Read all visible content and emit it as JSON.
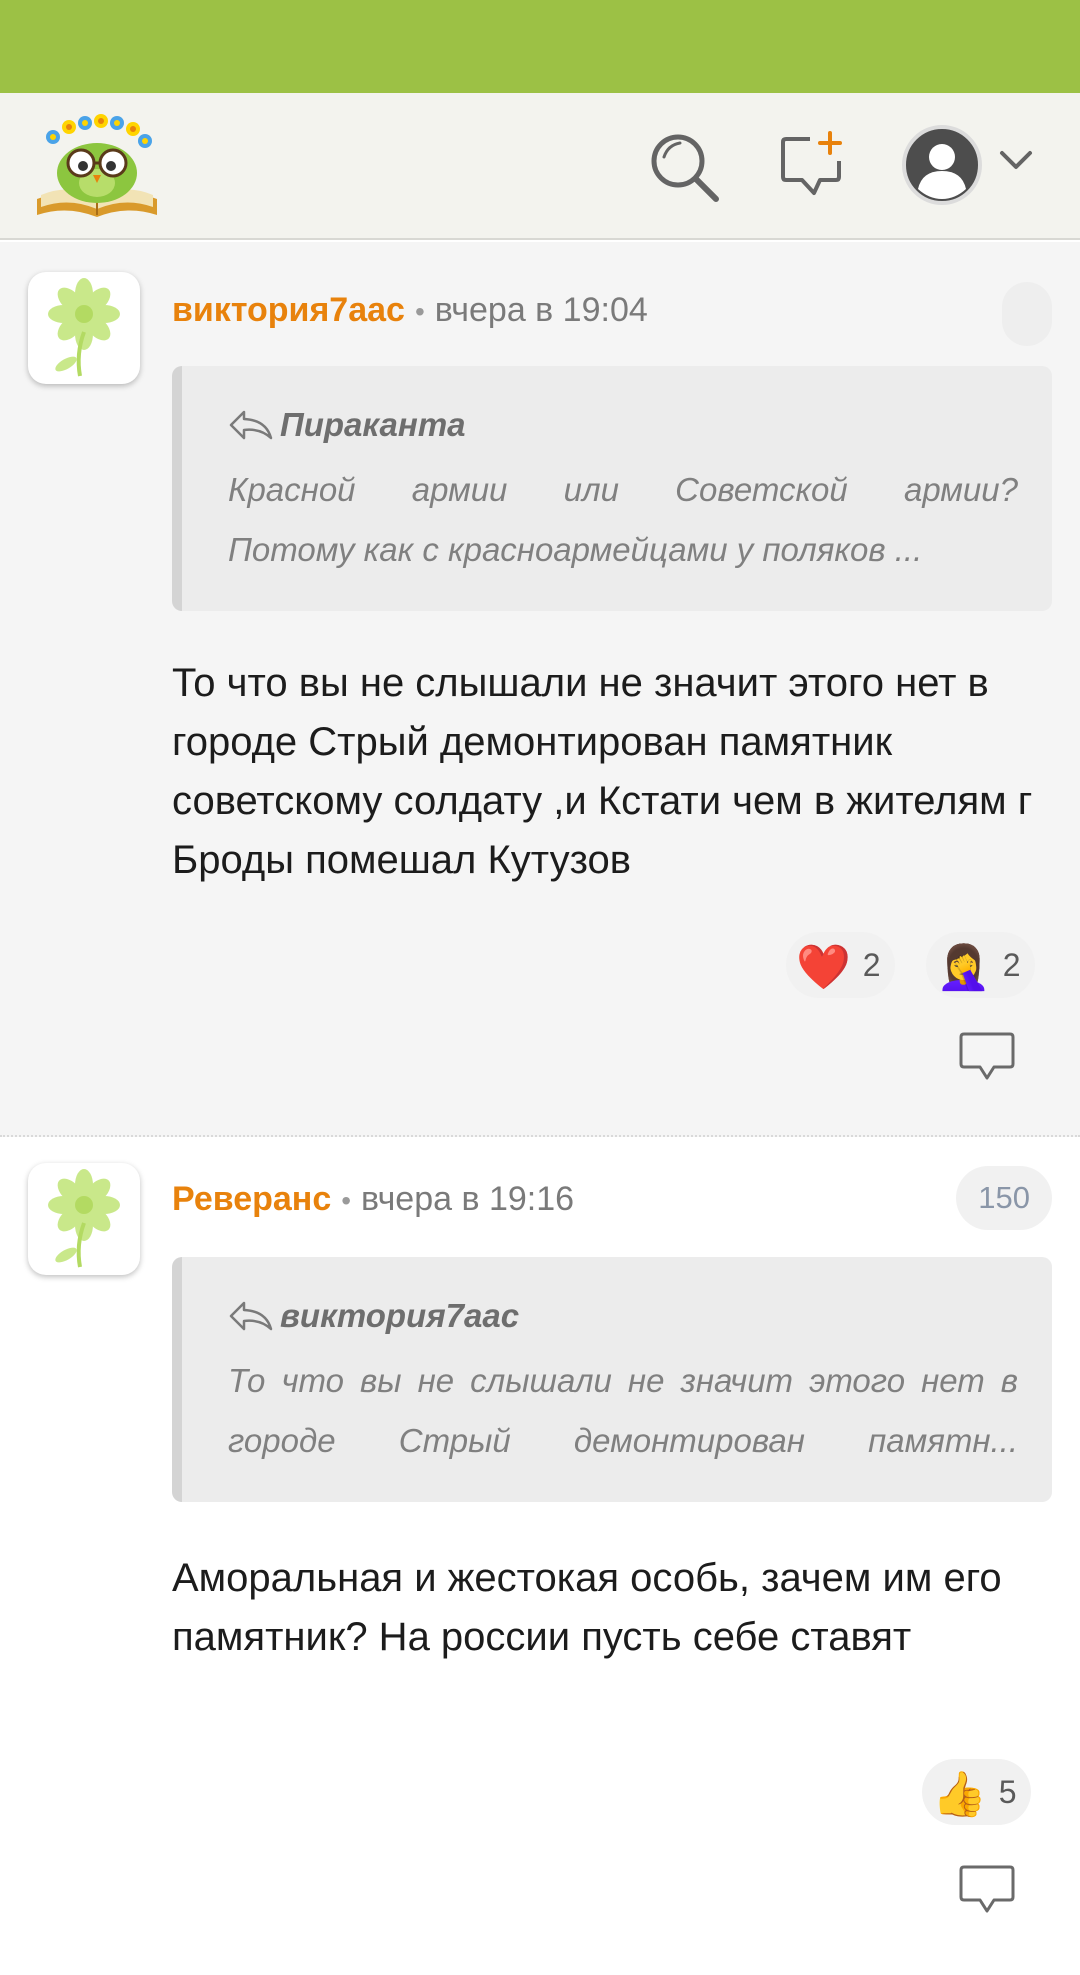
{
  "header": {
    "logo_icon": "owl-with-flowers-on-book-logo",
    "search_icon": "search-icon",
    "new_topic_icon": "new-message-plus-icon",
    "profile_icon": "user-avatar-icon",
    "menu_icon": "chevron-down-icon"
  },
  "colors": {
    "statusbar": "#9cc145",
    "header_bg": "#f3f3ee",
    "author": "#e8820c",
    "icon": "#646464"
  },
  "comments": [
    {
      "author": "виктория7аас",
      "time": "вчера в 19:04",
      "counter": "",
      "quote": {
        "author": "Пираканта",
        "line1": "Красной армии или Советской армии?",
        "line2": "Потому как с красноармейцами у поляков ..."
      },
      "text": "То что вы не слышали не значит этого нет в городе Стрый демонтирован памятник советскому солдату ,и Кстати чем в жителям г Броды помешал Кутузов",
      "reactions": [
        {
          "emoji": "❤️",
          "name": "heart",
          "count": "2"
        },
        {
          "emoji": "🤦‍♀️",
          "name": "facepalm",
          "count": "2"
        }
      ]
    },
    {
      "author": "Реверанс",
      "time": "вчера в 19:16",
      "counter": "150",
      "quote": {
        "author": "виктория7аас",
        "line1": "То что вы не слышали не значит этого нет в",
        "line2": "городе Стрый демонтирован памятн..."
      },
      "text": "Аморальная и жестокая особь, зачем им его памятник? На россии пусть себе ставят",
      "reactions": [
        {
          "emoji": "👍",
          "name": "thumbs-up",
          "count": "5"
        }
      ]
    }
  ]
}
